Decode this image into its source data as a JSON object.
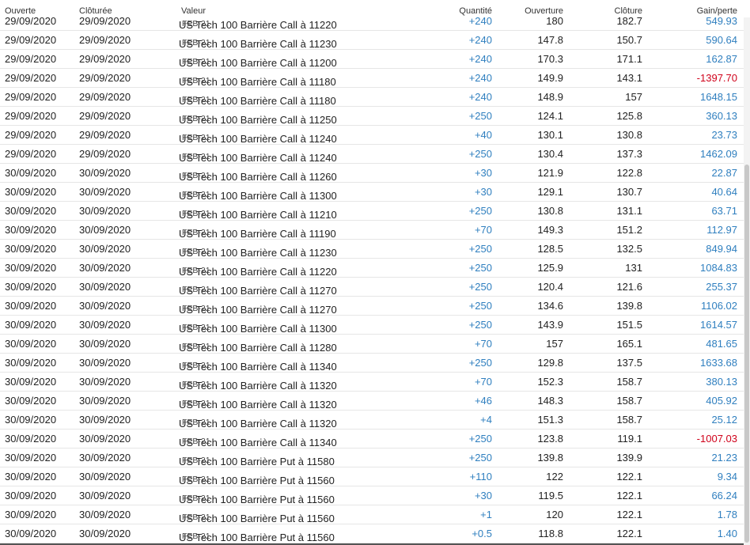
{
  "header": {
    "open": "Ouverte",
    "close": "Clôturée",
    "value": "Valeur",
    "qty": "Quantité",
    "open_price": "Ouverture",
    "close_price": "Clôture",
    "gain": "Gain/perte"
  },
  "rows": [
    {
      "open": "29/09/2020",
      "close": "29/09/2020",
      "name": "US Tech 100 Barrière Call à 11220",
      "exp": "FEB-21",
      "qty": "+240",
      "op": "180",
      "cp": "182.7",
      "gain": "549.93",
      "sign": "pos"
    },
    {
      "open": "29/09/2020",
      "close": "29/09/2020",
      "name": "US Tech 100 Barrière Call à 11230",
      "exp": "FEB-21",
      "qty": "+240",
      "op": "147.8",
      "cp": "150.7",
      "gain": "590.64",
      "sign": "pos"
    },
    {
      "open": "29/09/2020",
      "close": "29/09/2020",
      "name": "US Tech 100 Barrière Call à 11200",
      "exp": "FEB-21",
      "qty": "+240",
      "op": "170.3",
      "cp": "171.1",
      "gain": "162.87",
      "sign": "pos"
    },
    {
      "open": "29/09/2020",
      "close": "29/09/2020",
      "name": "US Tech 100 Barrière Call à 11180",
      "exp": "FEB-21",
      "qty": "+240",
      "op": "149.9",
      "cp": "143.1",
      "gain": "-1397.70",
      "sign": "neg"
    },
    {
      "open": "29/09/2020",
      "close": "29/09/2020",
      "name": "US Tech 100 Barrière Call à 11180",
      "exp": "FEB-21",
      "qty": "+240",
      "op": "148.9",
      "cp": "157",
      "gain": "1648.15",
      "sign": "pos"
    },
    {
      "open": "29/09/2020",
      "close": "29/09/2020",
      "name": "US Tech 100 Barrière Call à 11250",
      "exp": "FEB-21",
      "qty": "+250",
      "op": "124.1",
      "cp": "125.8",
      "gain": "360.13",
      "sign": "pos"
    },
    {
      "open": "29/09/2020",
      "close": "29/09/2020",
      "name": "US Tech 100 Barrière Call à 11240",
      "exp": "FEB-21",
      "qty": "+40",
      "op": "130.1",
      "cp": "130.8",
      "gain": "23.73",
      "sign": "pos"
    },
    {
      "open": "29/09/2020",
      "close": "29/09/2020",
      "name": "US Tech 100 Barrière Call à 11240",
      "exp": "FEB-21",
      "qty": "+250",
      "op": "130.4",
      "cp": "137.3",
      "gain": "1462.09",
      "sign": "pos"
    },
    {
      "open": "30/09/2020",
      "close": "30/09/2020",
      "name": "US Tech 100 Barrière Call à 11260",
      "exp": "FEB-21",
      "qty": "+30",
      "op": "121.9",
      "cp": "122.8",
      "gain": "22.87",
      "sign": "pos"
    },
    {
      "open": "30/09/2020",
      "close": "30/09/2020",
      "name": "US Tech 100 Barrière Call à 11300",
      "exp": "FEB-21",
      "qty": "+30",
      "op": "129.1",
      "cp": "130.7",
      "gain": "40.64",
      "sign": "pos"
    },
    {
      "open": "30/09/2020",
      "close": "30/09/2020",
      "name": "US Tech 100 Barrière Call à 11210",
      "exp": "FEB-21",
      "qty": "+250",
      "op": "130.8",
      "cp": "131.1",
      "gain": "63.71",
      "sign": "pos"
    },
    {
      "open": "30/09/2020",
      "close": "30/09/2020",
      "name": "US Tech 100 Barrière Call à 11190",
      "exp": "FEB-21",
      "qty": "+70",
      "op": "149.3",
      "cp": "151.2",
      "gain": "112.97",
      "sign": "pos"
    },
    {
      "open": "30/09/2020",
      "close": "30/09/2020",
      "name": "US Tech 100 Barrière Call à 11230",
      "exp": "FEB-21",
      "qty": "+250",
      "op": "128.5",
      "cp": "132.5",
      "gain": "849.94",
      "sign": "pos"
    },
    {
      "open": "30/09/2020",
      "close": "30/09/2020",
      "name": "US Tech 100 Barrière Call à 11220",
      "exp": "FEB-21",
      "qty": "+250",
      "op": "125.9",
      "cp": "131",
      "gain": "1084.83",
      "sign": "pos"
    },
    {
      "open": "30/09/2020",
      "close": "30/09/2020",
      "name": "US Tech 100 Barrière Call à 11270",
      "exp": "FEB-21",
      "qty": "+250",
      "op": "120.4",
      "cp": "121.6",
      "gain": "255.37",
      "sign": "pos"
    },
    {
      "open": "30/09/2020",
      "close": "30/09/2020",
      "name": "US Tech 100 Barrière Call à 11270",
      "exp": "FEB-21",
      "qty": "+250",
      "op": "134.6",
      "cp": "139.8",
      "gain": "1106.02",
      "sign": "pos"
    },
    {
      "open": "30/09/2020",
      "close": "30/09/2020",
      "name": "US Tech 100 Barrière Call à 11300",
      "exp": "FEB-21",
      "qty": "+250",
      "op": "143.9",
      "cp": "151.5",
      "gain": "1614.57",
      "sign": "pos"
    },
    {
      "open": "30/09/2020",
      "close": "30/09/2020",
      "name": "US Tech 100 Barrière Call à 11280",
      "exp": "FEB-21",
      "qty": "+70",
      "op": "157",
      "cp": "165.1",
      "gain": "481.65",
      "sign": "pos"
    },
    {
      "open": "30/09/2020",
      "close": "30/09/2020",
      "name": "US Tech 100 Barrière Call à 11340",
      "exp": "FEB-21",
      "qty": "+250",
      "op": "129.8",
      "cp": "137.5",
      "gain": "1633.68",
      "sign": "pos"
    },
    {
      "open": "30/09/2020",
      "close": "30/09/2020",
      "name": "US Tech 100 Barrière Call à 11320",
      "exp": "FEB-21",
      "qty": "+70",
      "op": "152.3",
      "cp": "158.7",
      "gain": "380.13",
      "sign": "pos"
    },
    {
      "open": "30/09/2020",
      "close": "30/09/2020",
      "name": "US Tech 100 Barrière Call à 11320",
      "exp": "FEB-21",
      "qty": "+46",
      "op": "148.3",
      "cp": "158.7",
      "gain": "405.92",
      "sign": "pos"
    },
    {
      "open": "30/09/2020",
      "close": "30/09/2020",
      "name": "US Tech 100 Barrière Call à 11320",
      "exp": "FEB-21",
      "qty": "+4",
      "op": "151.3",
      "cp": "158.7",
      "gain": "25.12",
      "sign": "pos"
    },
    {
      "open": "30/09/2020",
      "close": "30/09/2020",
      "name": "US Tech 100 Barrière Call à 11340",
      "exp": "FEB-21",
      "qty": "+250",
      "op": "123.8",
      "cp": "119.1",
      "gain": "-1007.03",
      "sign": "neg"
    },
    {
      "open": "30/09/2020",
      "close": "30/09/2020",
      "name": "US Tech 100 Barrière Put à 11580",
      "exp": "FEB-21",
      "qty": "+250",
      "op": "139.8",
      "cp": "139.9",
      "gain": "21.23",
      "sign": "pos"
    },
    {
      "open": "30/09/2020",
      "close": "30/09/2020",
      "name": "US Tech 100 Barrière Put à 11560",
      "exp": "FEB-21",
      "qty": "+110",
      "op": "122",
      "cp": "122.1",
      "gain": "9.34",
      "sign": "pos"
    },
    {
      "open": "30/09/2020",
      "close": "30/09/2020",
      "name": "US Tech 100 Barrière Put à 11560",
      "exp": "FEB-21",
      "qty": "+30",
      "op": "119.5",
      "cp": "122.1",
      "gain": "66.24",
      "sign": "pos"
    },
    {
      "open": "30/09/2020",
      "close": "30/09/2020",
      "name": "US Tech 100 Barrière Put à 11560",
      "exp": "FEB-21",
      "qty": "+1",
      "op": "120",
      "cp": "122.1",
      "gain": "1.78",
      "sign": "pos"
    },
    {
      "open": "30/09/2020",
      "close": "30/09/2020",
      "name": "US Tech 100 Barrière Put à 11560",
      "exp": "FEB-21",
      "qty": "+0.5",
      "op": "118.8",
      "cp": "122.1",
      "gain": "1.40",
      "sign": "pos"
    }
  ]
}
